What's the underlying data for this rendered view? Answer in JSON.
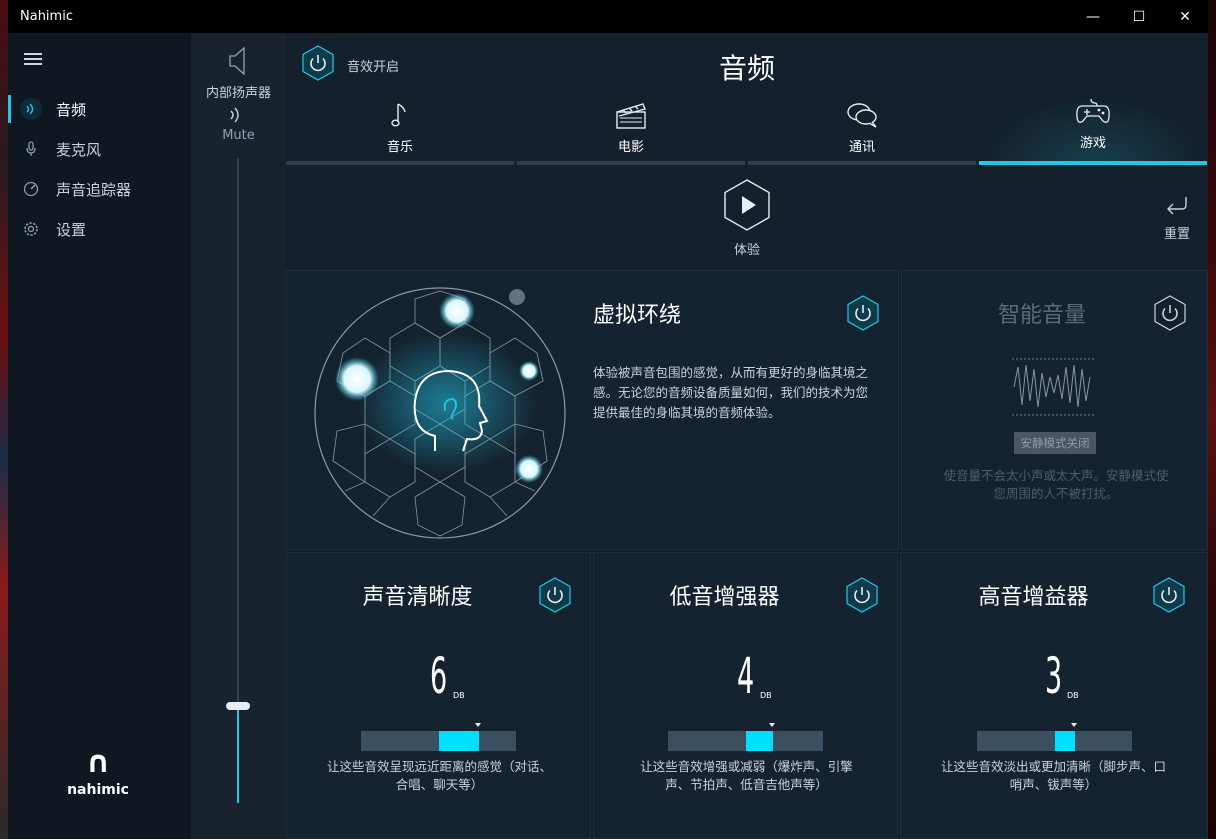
{
  "window": {
    "title": "Nahimic",
    "minimize": "—",
    "maximize": "☐",
    "close": "✕"
  },
  "sidebar": {
    "items": [
      {
        "label": "音频",
        "icon": "speaker-wave-icon",
        "active": true
      },
      {
        "label": "麦克风",
        "icon": "microphone-icon",
        "active": false
      },
      {
        "label": "声音追踪器",
        "icon": "sound-tracker-icon",
        "active": false
      },
      {
        "label": "设置",
        "icon": "gear-icon",
        "active": false
      }
    ],
    "logo": {
      "mark": "∩",
      "text": "nahimic"
    }
  },
  "device": {
    "name": "内部扬声器",
    "status": "Mute",
    "volume_fraction": 0.15
  },
  "header": {
    "power_label": "音效开启",
    "title": "音频"
  },
  "tabs": [
    {
      "label": "音乐",
      "icon": "music-note-icon",
      "active": false
    },
    {
      "label": "电影",
      "icon": "clapperboard-icon",
      "active": false
    },
    {
      "label": "通讯",
      "icon": "chat-bubbles-icon",
      "active": false
    },
    {
      "label": "游戏",
      "icon": "gamepad-icon",
      "active": true
    }
  ],
  "experience": {
    "label": "体验",
    "reset_label": "重置"
  },
  "virtual_surround": {
    "title": "虚拟环绕",
    "description": "体验被声音包围的感觉，从而有更好的身临其境之感。无论您的音频设备质量如何，我们的技术为您提供最佳的身临其境的音频体验。"
  },
  "smart_volume": {
    "title": "智能音量",
    "badge": "安静模式关闭",
    "description": "使音量不会太小声或太大声。安静模式使您周围的人不被打扰。"
  },
  "effects": [
    {
      "title": "声音清晰度",
      "value": "6",
      "unit": "DB",
      "level": 6,
      "description": "让这些音效呈现远近距离的感觉（对话、合唱、聊天等）"
    },
    {
      "title": "低音增强器",
      "value": "4",
      "unit": "DB",
      "level": 4,
      "description": "让这些音效增强或减弱（爆炸声、引擎声、节拍声、低音吉他声等）"
    },
    {
      "title": "高音增益器",
      "value": "3",
      "unit": "DB",
      "level": 3,
      "description": "让这些音效淡出或更加清晰（脚步声、口哨声、钹声等）"
    }
  ],
  "colors": {
    "accent": "#21c7e6",
    "bar_fill": "#00dfff",
    "background": "#14202c"
  }
}
